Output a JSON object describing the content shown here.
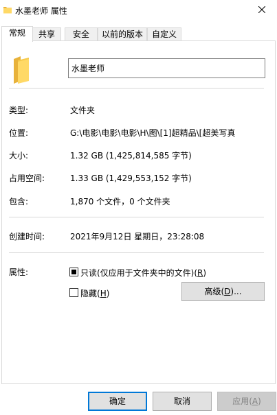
{
  "window": {
    "title": "水墨老师 属性"
  },
  "tabs": [
    {
      "label": "常规",
      "active": true
    },
    {
      "label": "共享"
    },
    {
      "label": "安全"
    },
    {
      "label": "以前的版本"
    },
    {
      "label": "自定义"
    }
  ],
  "general": {
    "name_value": "水墨老师",
    "type_label": "类型:",
    "type_value": "文件夹",
    "location_label": "位置:",
    "location_value": "G:\\电影\\电影\\电影\\H\\图\\[1]超精品\\[超美写真",
    "size_label": "大小:",
    "size_value": "1.32 GB (1,425,814,585 字节)",
    "disk_size_label": "占用空间:",
    "disk_size_value": "1.33 GB (1,429,553,152 字节)",
    "contains_label": "包含:",
    "contains_value": "1,870 个文件，0 个文件夹",
    "created_label": "创建时间:",
    "created_value": "2021年9月12日 星期日，23:28:08",
    "attributes_label": "属性:",
    "readonly_label": "只读(仅应用于文件夹中的文件)(",
    "readonly_key": "R",
    "readonly_close": ")",
    "readonly_state": "indeterminate",
    "hidden_label": "隐藏(",
    "hidden_key": "H",
    "hidden_close": ")",
    "hidden_checked": false,
    "advanced_label": "高级(",
    "advanced_key": "D",
    "advanced_close": ")..."
  },
  "footer": {
    "ok_label": "确定",
    "cancel_label": "取消",
    "apply_label": "应用(",
    "apply_key": "A",
    "apply_close": ")"
  },
  "colors": {
    "folder": "#ffd966",
    "accent": "#0078d7"
  }
}
